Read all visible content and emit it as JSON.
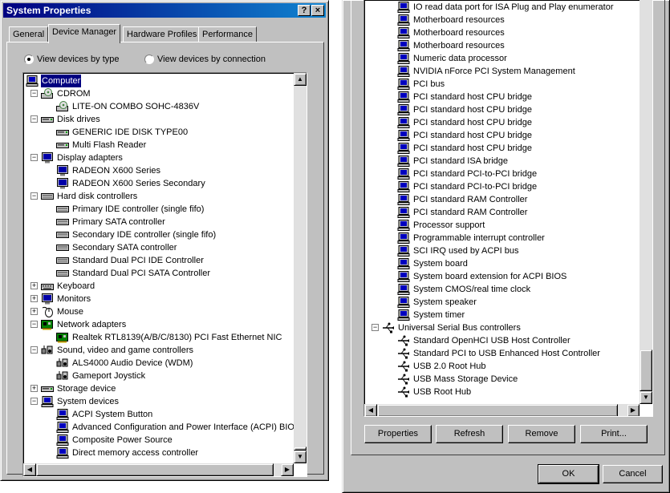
{
  "window": {
    "title": "System Properties",
    "help_button": "?",
    "close_button": "×"
  },
  "tabs": [
    {
      "label": "General",
      "active": false
    },
    {
      "label": "Device Manager",
      "active": true
    },
    {
      "label": "Hardware Profiles",
      "active": false
    },
    {
      "label": "Performance",
      "active": false
    }
  ],
  "view_options": {
    "by_type": "View devices by type",
    "by_connection": "View devices by connection",
    "selected": "by_type"
  },
  "left_tree": [
    {
      "label": "Computer",
      "level": 0,
      "icon": "computer-icon",
      "expander": "",
      "selected": true
    },
    {
      "label": "CDROM",
      "level": 1,
      "icon": "cdrom-icon",
      "expander": "-"
    },
    {
      "label": "LITE-ON COMBO SOHC-4836V",
      "level": 2,
      "icon": "cdrom-icon",
      "expander": ""
    },
    {
      "label": "Disk drives",
      "level": 1,
      "icon": "disk-icon",
      "expander": "-"
    },
    {
      "label": "GENERIC IDE  DISK TYPE00",
      "level": 2,
      "icon": "disk-icon",
      "expander": ""
    },
    {
      "label": "Multi Flash Reader",
      "level": 2,
      "icon": "disk-icon",
      "expander": ""
    },
    {
      "label": "Display adapters",
      "level": 1,
      "icon": "monitor-icon",
      "expander": "-"
    },
    {
      "label": "RADEON X600 Series",
      "level": 2,
      "icon": "monitor-icon",
      "expander": ""
    },
    {
      "label": "RADEON X600 Series Secondary",
      "level": 2,
      "icon": "monitor-icon",
      "expander": ""
    },
    {
      "label": "Hard disk controllers",
      "level": 1,
      "icon": "controller-icon",
      "expander": "-"
    },
    {
      "label": "Primary IDE controller (single fifo)",
      "level": 2,
      "icon": "controller-icon",
      "expander": ""
    },
    {
      "label": "Primary SATA controller",
      "level": 2,
      "icon": "controller-icon",
      "expander": ""
    },
    {
      "label": "Secondary IDE controller (single fifo)",
      "level": 2,
      "icon": "controller-icon",
      "expander": ""
    },
    {
      "label": "Secondary SATA controller",
      "level": 2,
      "icon": "controller-icon",
      "expander": ""
    },
    {
      "label": "Standard Dual PCI IDE Controller",
      "level": 2,
      "icon": "controller-icon",
      "expander": ""
    },
    {
      "label": "Standard Dual PCI SATA Controller",
      "level": 2,
      "icon": "controller-icon",
      "expander": ""
    },
    {
      "label": "Keyboard",
      "level": 1,
      "icon": "keyboard-icon",
      "expander": "+"
    },
    {
      "label": "Monitors",
      "level": 1,
      "icon": "monitor-icon",
      "expander": "+"
    },
    {
      "label": "Mouse",
      "level": 1,
      "icon": "mouse-icon",
      "expander": "+"
    },
    {
      "label": "Network adapters",
      "level": 1,
      "icon": "network-card-icon",
      "expander": "-"
    },
    {
      "label": "Realtek RTL8139(A/B/C/8130) PCI Fast Ethernet NIC",
      "level": 2,
      "icon": "network-card-icon",
      "expander": ""
    },
    {
      "label": "Sound, video and game controllers",
      "level": 1,
      "icon": "sound-icon",
      "expander": "-"
    },
    {
      "label": "ALS4000 Audio Device (WDM)",
      "level": 2,
      "icon": "sound-icon",
      "expander": ""
    },
    {
      "label": "Gameport Joystick",
      "level": 2,
      "icon": "sound-icon",
      "expander": ""
    },
    {
      "label": "Storage device",
      "level": 1,
      "icon": "disk-icon",
      "expander": "+"
    },
    {
      "label": "System devices",
      "level": 1,
      "icon": "computer-icon",
      "expander": "-"
    },
    {
      "label": "ACPI System Button",
      "level": 2,
      "icon": "computer-icon",
      "expander": ""
    },
    {
      "label": "Advanced Configuration and Power Interface (ACPI) BIOS",
      "level": 2,
      "icon": "computer-icon",
      "expander": ""
    },
    {
      "label": "Composite Power Source",
      "level": 2,
      "icon": "computer-icon",
      "expander": ""
    },
    {
      "label": "Direct memory access controller",
      "level": 2,
      "icon": "computer-icon",
      "expander": ""
    }
  ],
  "right_tree": [
    {
      "label": "IO read data port for ISA Plug and Play enumerator",
      "level": 2,
      "icon": "computer-icon",
      "expander": ""
    },
    {
      "label": "Motherboard resources",
      "level": 2,
      "icon": "computer-icon",
      "expander": ""
    },
    {
      "label": "Motherboard resources",
      "level": 2,
      "icon": "computer-icon",
      "expander": ""
    },
    {
      "label": "Motherboard resources",
      "level": 2,
      "icon": "computer-icon",
      "expander": ""
    },
    {
      "label": "Numeric data processor",
      "level": 2,
      "icon": "computer-icon",
      "expander": ""
    },
    {
      "label": "NVIDIA nForce PCI System Management",
      "level": 2,
      "icon": "computer-icon",
      "expander": ""
    },
    {
      "label": "PCI bus",
      "level": 2,
      "icon": "computer-icon",
      "expander": ""
    },
    {
      "label": "PCI standard host CPU bridge",
      "level": 2,
      "icon": "computer-icon",
      "expander": ""
    },
    {
      "label": "PCI standard host CPU bridge",
      "level": 2,
      "icon": "computer-icon",
      "expander": ""
    },
    {
      "label": "PCI standard host CPU bridge",
      "level": 2,
      "icon": "computer-icon",
      "expander": ""
    },
    {
      "label": "PCI standard host CPU bridge",
      "level": 2,
      "icon": "computer-icon",
      "expander": ""
    },
    {
      "label": "PCI standard host CPU bridge",
      "level": 2,
      "icon": "computer-icon",
      "expander": ""
    },
    {
      "label": "PCI standard ISA bridge",
      "level": 2,
      "icon": "computer-icon",
      "expander": ""
    },
    {
      "label": "PCI standard PCI-to-PCI bridge",
      "level": 2,
      "icon": "computer-icon",
      "expander": ""
    },
    {
      "label": "PCI standard PCI-to-PCI bridge",
      "level": 2,
      "icon": "computer-icon",
      "expander": ""
    },
    {
      "label": "PCI standard RAM Controller",
      "level": 2,
      "icon": "computer-icon",
      "expander": ""
    },
    {
      "label": "PCI standard RAM Controller",
      "level": 2,
      "icon": "computer-icon",
      "expander": ""
    },
    {
      "label": "Processor support",
      "level": 2,
      "icon": "computer-icon",
      "expander": ""
    },
    {
      "label": "Programmable interrupt controller",
      "level": 2,
      "icon": "computer-icon",
      "expander": ""
    },
    {
      "label": "SCI IRQ used by ACPI bus",
      "level": 2,
      "icon": "computer-icon",
      "expander": ""
    },
    {
      "label": "System board",
      "level": 2,
      "icon": "computer-icon",
      "expander": ""
    },
    {
      "label": "System board extension for ACPI BIOS",
      "level": 2,
      "icon": "computer-icon",
      "expander": ""
    },
    {
      "label": "System CMOS/real time clock",
      "level": 2,
      "icon": "computer-icon",
      "expander": ""
    },
    {
      "label": "System speaker",
      "level": 2,
      "icon": "computer-icon",
      "expander": ""
    },
    {
      "label": "System timer",
      "level": 2,
      "icon": "computer-icon",
      "expander": ""
    },
    {
      "label": "Universal Serial Bus controllers",
      "level": 1,
      "icon": "usb-icon",
      "expander": "-"
    },
    {
      "label": "Standard OpenHCI USB Host Controller",
      "level": 2,
      "icon": "usb-icon",
      "expander": ""
    },
    {
      "label": "Standard PCI to USB Enhanced Host Controller",
      "level": 2,
      "icon": "usb-icon",
      "expander": ""
    },
    {
      "label": "USB 2.0 Root Hub",
      "level": 2,
      "icon": "usb-icon",
      "expander": ""
    },
    {
      "label": "USB Mass Storage Device",
      "level": 2,
      "icon": "usb-icon",
      "expander": ""
    },
    {
      "label": "USB Root Hub",
      "level": 2,
      "icon": "usb-icon",
      "expander": ""
    }
  ],
  "buttons": {
    "properties": "Properties",
    "refresh": "Refresh",
    "remove": "Remove",
    "print": "Print...",
    "ok": "OK",
    "cancel": "Cancel"
  },
  "colors": {
    "title_start": "#000080",
    "title_end": "#1084d0",
    "face": "#c0c0c0",
    "selection": "#000080"
  }
}
